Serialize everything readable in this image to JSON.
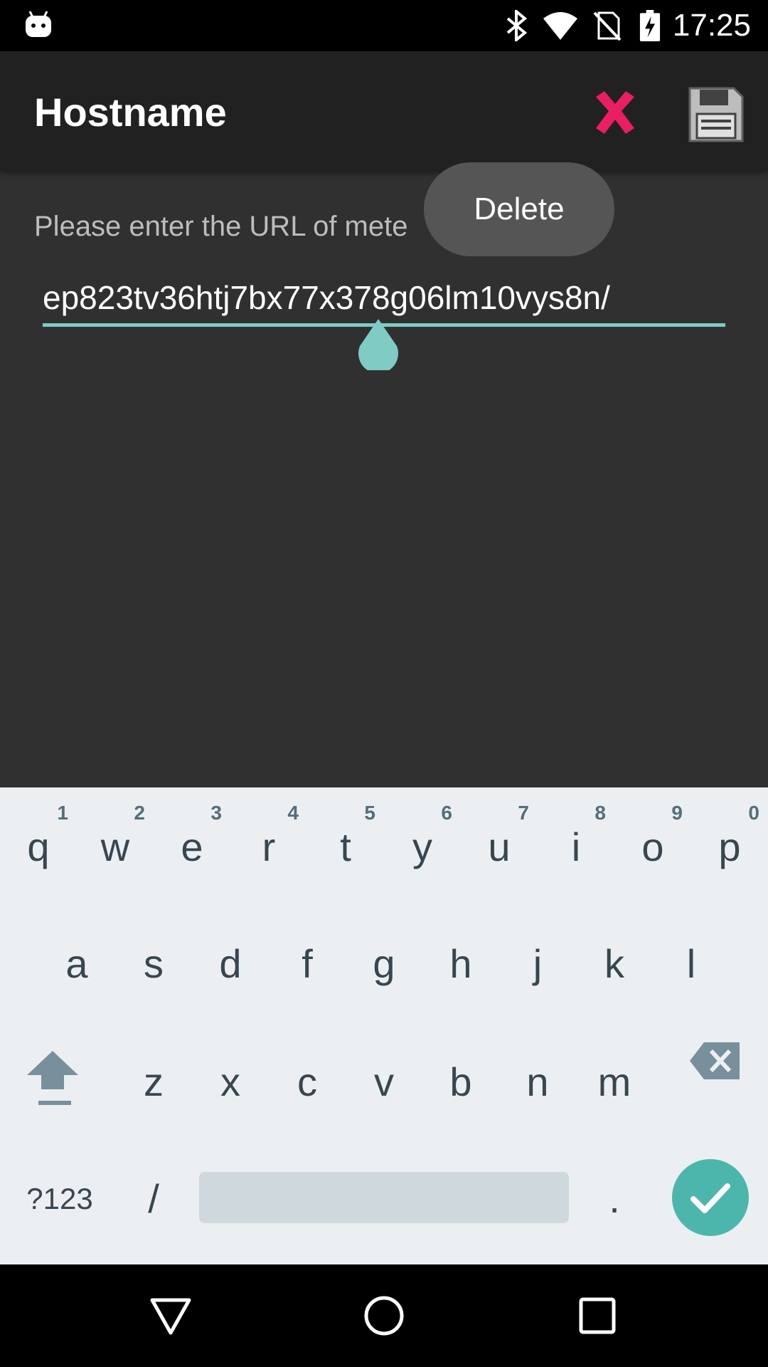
{
  "status_bar": {
    "time": "17:25",
    "icons": [
      "android-icon",
      "bluetooth-icon",
      "wifi-icon",
      "no-sim-icon",
      "battery-charging-icon"
    ]
  },
  "app_bar": {
    "title": "Hostname",
    "actions": [
      {
        "name": "close-icon",
        "color": "#e91e63"
      },
      {
        "name": "save-icon",
        "color": "#9e9e9e"
      }
    ]
  },
  "content": {
    "hint": "Please enter the URL of mete",
    "url_value": "ep823tv36htj7bx77x378g06lm10vys8n/",
    "accent_color": "#80cbc4"
  },
  "popup": {
    "label": "Delete"
  },
  "keyboard": {
    "row1": [
      "q",
      "w",
      "e",
      "r",
      "t",
      "y",
      "u",
      "i",
      "o",
      "p"
    ],
    "row1_hints": [
      "1",
      "2",
      "3",
      "4",
      "5",
      "6",
      "7",
      "8",
      "9",
      "0"
    ],
    "row2": [
      "a",
      "s",
      "d",
      "f",
      "g",
      "h",
      "j",
      "k",
      "l"
    ],
    "row3": [
      "z",
      "x",
      "c",
      "v",
      "b",
      "n",
      "m"
    ],
    "symbols_label": "?123",
    "slash": "/",
    "period": ".",
    "enter_color": "#4db6ac"
  },
  "nav_bar": {
    "buttons": [
      "back-icon",
      "home-icon",
      "recents-icon"
    ]
  }
}
